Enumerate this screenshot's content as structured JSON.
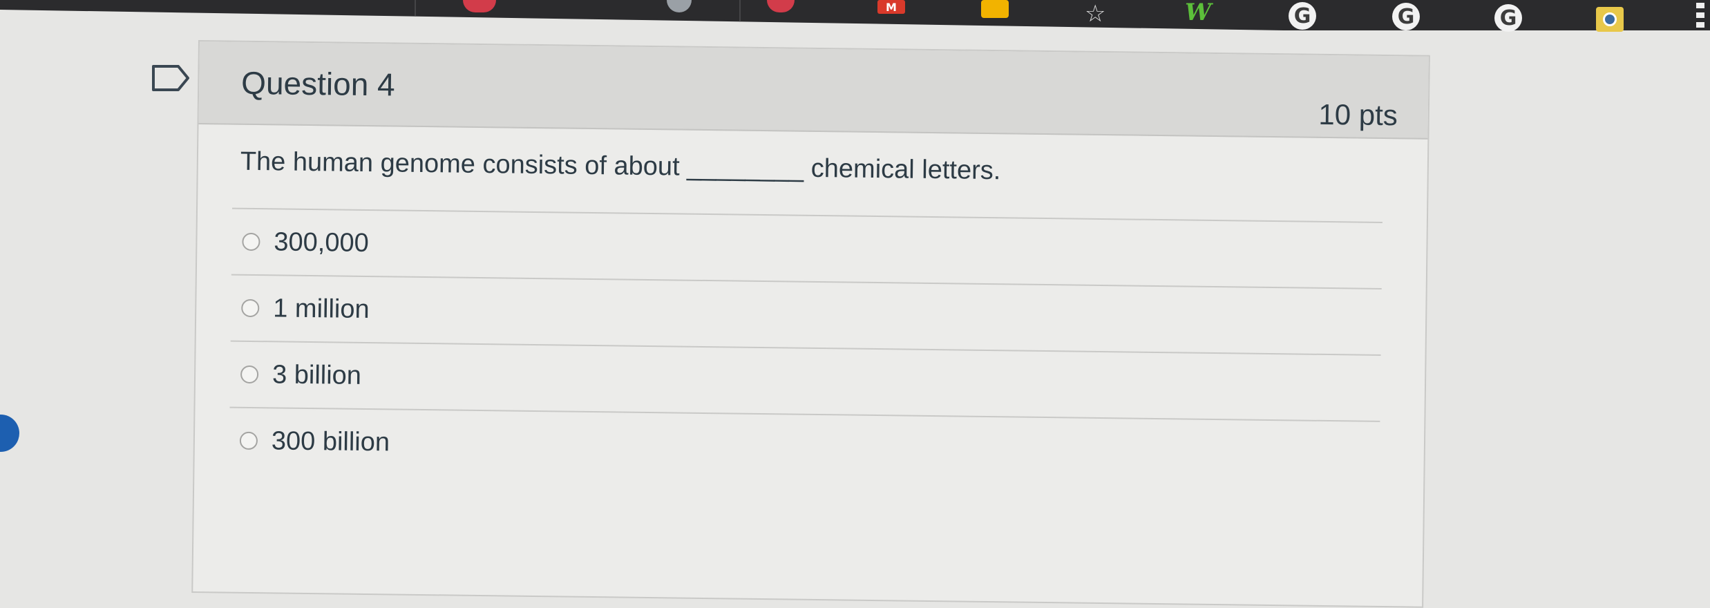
{
  "question": {
    "title": "Question 4",
    "points": "10 pts",
    "text": "The human genome consists of about ________ chemical letters."
  },
  "answers": [
    {
      "label": "300,000"
    },
    {
      "label": "1 million"
    },
    {
      "label": "3 billion"
    },
    {
      "label": "300 billion"
    }
  ],
  "bookmarks": {
    "m_label": "M",
    "w_label": "W",
    "g_label": "G",
    "star": "☆"
  },
  "colors": {
    "text": "#2d3b45",
    "card_bg": "#ececea",
    "header_bg": "#d8d8d6",
    "accent_blue": "#1d5fb0"
  }
}
